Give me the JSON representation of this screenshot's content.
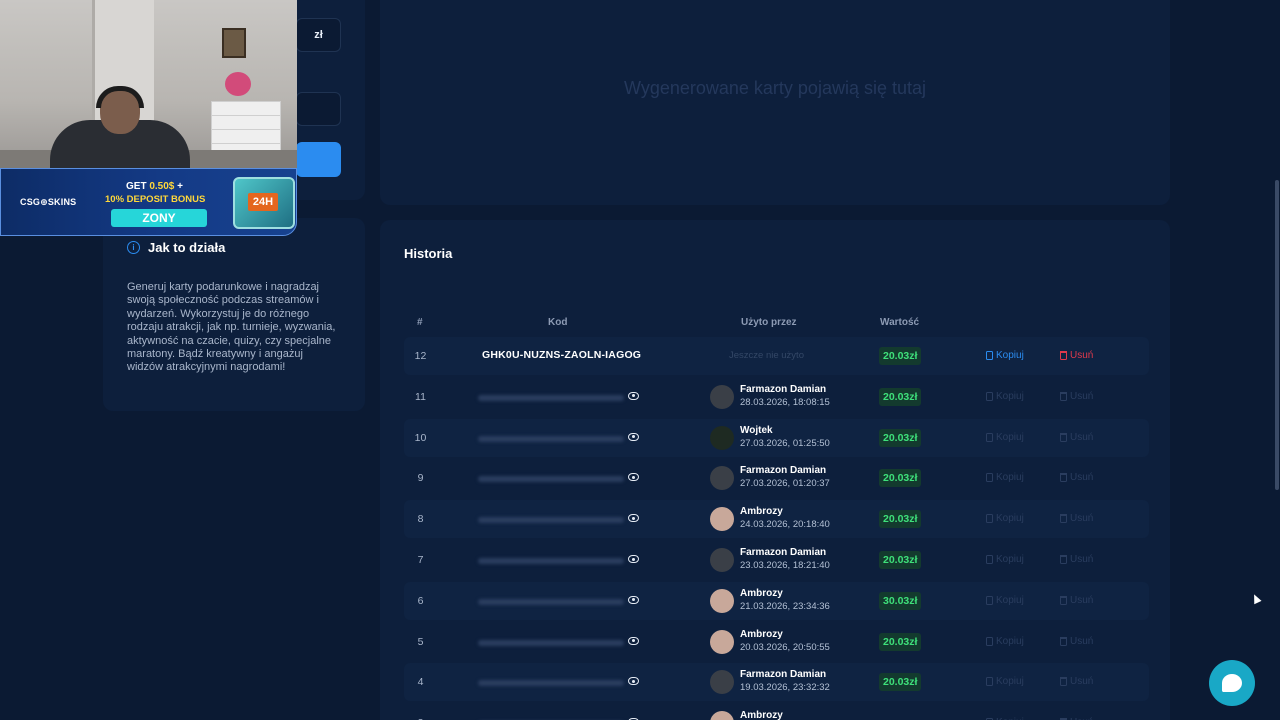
{
  "setup": {
    "currency": "zł"
  },
  "sponsor": {
    "logo": "CSG⊕SKINS",
    "get_prefix": "GET ",
    "get_amount": "0.50$",
    "get_suffix": " +",
    "bonus": "10% DEPOSIT BONUS",
    "code": "ZONY",
    "case_label": "24H"
  },
  "generated": {
    "placeholder": "Wygenerowane karty pojawią się tutaj"
  },
  "howto": {
    "title": "Jak to działa",
    "text": "Generuj karty podarunkowe i nagradzaj swoją społeczność podczas streamów i wydarzeń. Wykorzystuj je do różnego rodzaju atrakcji, jak np. turnieje, wyzwania, aktywność na czacie, quizy, czy specjalne maratony. Bądź kreatywny i angażuj widzów atrakcyjnymi nagrodami!"
  },
  "history": {
    "title": "Historia",
    "columns": {
      "num": "#",
      "code": "Kod",
      "used_by": "Użyto przez",
      "value": "Wartość"
    },
    "copy_label": "Kopiuj",
    "delete_label": "Usuń",
    "not_used": "Jeszcze nie użyto",
    "rows": [
      {
        "num": "12",
        "code": "GHK0U-NUZNS-ZAOLN-IAGOG",
        "user": "",
        "date": "",
        "value": "20.03zł"
      },
      {
        "num": "11",
        "code": "",
        "user": "Farmazon Damian",
        "date": "28.03.2026, 18:08:15",
        "value": "20.03zł"
      },
      {
        "num": "10",
        "code": "",
        "user": "Wojtek",
        "date": "27.03.2026, 01:25:50",
        "value": "20.03zł"
      },
      {
        "num": "9",
        "code": "",
        "user": "Farmazon Damian",
        "date": "27.03.2026, 01:20:37",
        "value": "20.03zł"
      },
      {
        "num": "8",
        "code": "",
        "user": "Ambrozy",
        "date": "24.03.2026, 20:18:40",
        "value": "20.03zł"
      },
      {
        "num": "7",
        "code": "",
        "user": "Farmazon Damian",
        "date": "23.03.2026, 18:21:40",
        "value": "20.03zł"
      },
      {
        "num": "6",
        "code": "",
        "user": "Ambrozy",
        "date": "21.03.2026, 23:34:36",
        "value": "30.03zł"
      },
      {
        "num": "5",
        "code": "",
        "user": "Ambrozy",
        "date": "20.03.2026, 20:50:55",
        "value": "20.03zł"
      },
      {
        "num": "4",
        "code": "",
        "user": "Farmazon Damian",
        "date": "19.03.2026, 23:32:32",
        "value": "20.03zł"
      },
      {
        "num": "3",
        "code": "",
        "user": "Ambrozy",
        "date": "",
        "value": ""
      }
    ]
  }
}
